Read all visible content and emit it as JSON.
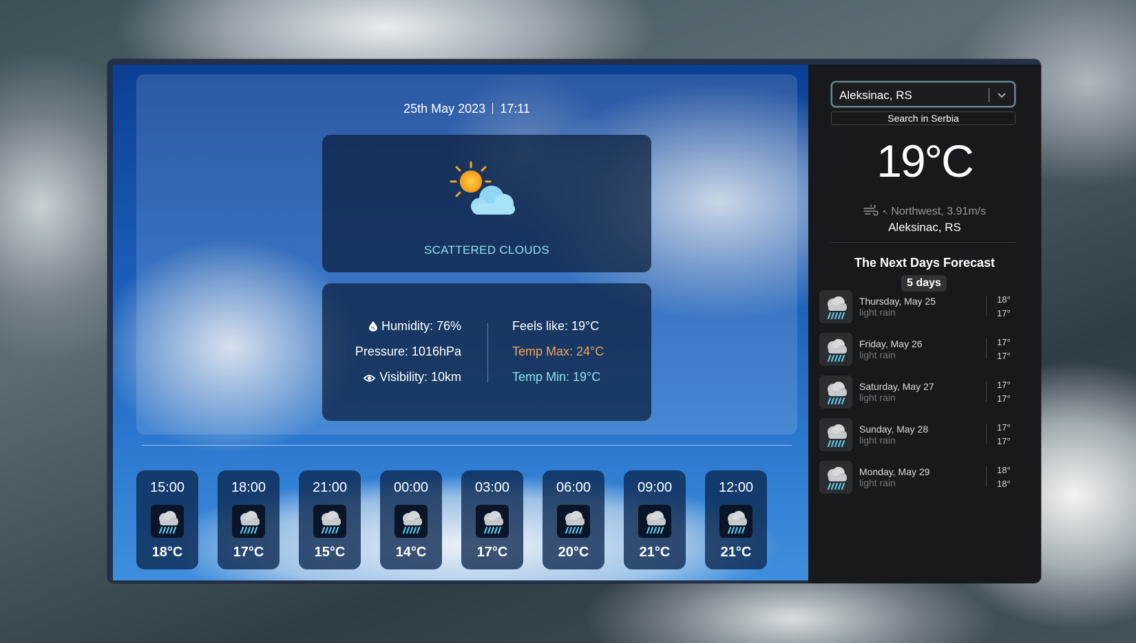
{
  "header": {
    "date": "25th May 2023",
    "time": "17:11"
  },
  "current": {
    "condition": "SCATTERED CLOUDS",
    "condition_icon": "sun-behind-cloud-icon",
    "humidity": "Humidity: 76%",
    "pressure": "Pressure: 1016hPa",
    "visibility": "Visibility: 10km",
    "feels_like": "Feels like: 19°C",
    "temp_max": "Temp Max: 24°C",
    "temp_min": "Temp Min: 19°C"
  },
  "hourly": [
    {
      "time": "15:00",
      "temp": "18°C",
      "icon": "rain-cloud-icon"
    },
    {
      "time": "18:00",
      "temp": "17°C",
      "icon": "rain-cloud-icon"
    },
    {
      "time": "21:00",
      "temp": "15°C",
      "icon": "rain-cloud-icon"
    },
    {
      "time": "00:00",
      "temp": "14°C",
      "icon": "rain-cloud-icon"
    },
    {
      "time": "03:00",
      "temp": "17°C",
      "icon": "rain-cloud-icon"
    },
    {
      "time": "06:00",
      "temp": "20°C",
      "icon": "rain-cloud-icon"
    },
    {
      "time": "09:00",
      "temp": "21°C",
      "icon": "rain-cloud-icon"
    },
    {
      "time": "12:00",
      "temp": "21°C",
      "icon": "rain-cloud-icon"
    }
  ],
  "sidebar": {
    "location_select": "Aleksinac, RS",
    "search_button": "Search in Serbia",
    "temperature": "19°C",
    "wind": "Northwest, 3.91m/s",
    "location": "Aleksinac, RS",
    "forecast_title": "The Next Days Forecast",
    "forecast_days_pill": "5 days",
    "forecast": [
      {
        "day": "Thursday, May 25",
        "desc": "light rain",
        "max": "18°",
        "min": "17°"
      },
      {
        "day": "Friday, May 26",
        "desc": "light rain",
        "max": "17°",
        "min": "17°"
      },
      {
        "day": "Saturday, May 27",
        "desc": "light rain",
        "max": "17°",
        "min": "17°"
      },
      {
        "day": "Sunday, May 28",
        "desc": "light rain",
        "max": "17°",
        "min": "17°"
      },
      {
        "day": "Monday, May 29",
        "desc": "light rain",
        "max": "18°",
        "min": "18°"
      }
    ]
  },
  "colors": {
    "accent_cyan": "#8ee0f0",
    "accent_orange": "#f2a45a"
  }
}
